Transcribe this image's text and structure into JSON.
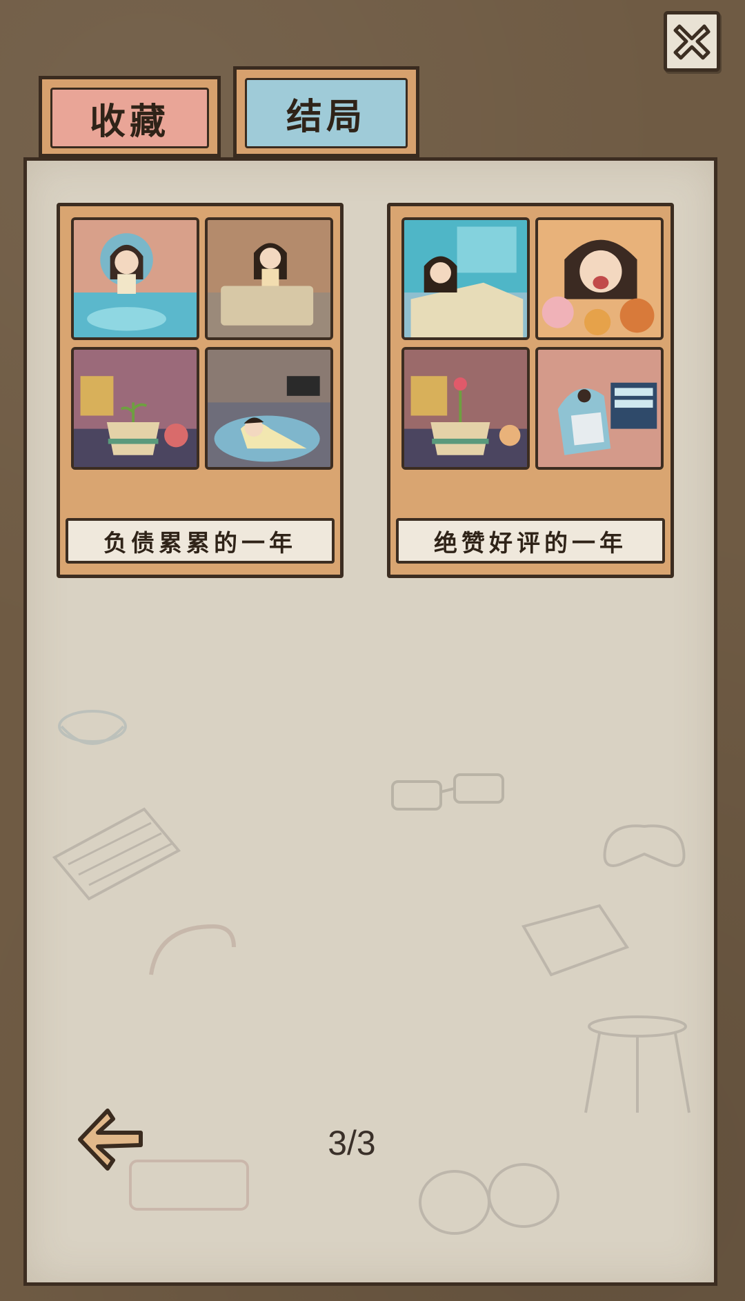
{
  "tabs": [
    {
      "label": "收藏",
      "active": false
    },
    {
      "label": "结局",
      "active": true
    }
  ],
  "endings": [
    {
      "title": "负债累累的一年"
    },
    {
      "title": "绝赞好评的一年"
    }
  ],
  "pagination": {
    "current": 3,
    "total": 3,
    "label": "3/3"
  },
  "icons": {
    "close": "close-icon",
    "back": "back-arrow-icon"
  },
  "colors": {
    "background": "#6f5b44",
    "panel": "#d9d2c3",
    "card_frame": "#d9a571",
    "tab_collect": "#e9a597",
    "tab_ending": "#9fcbd8",
    "outline": "#3c2d21"
  }
}
